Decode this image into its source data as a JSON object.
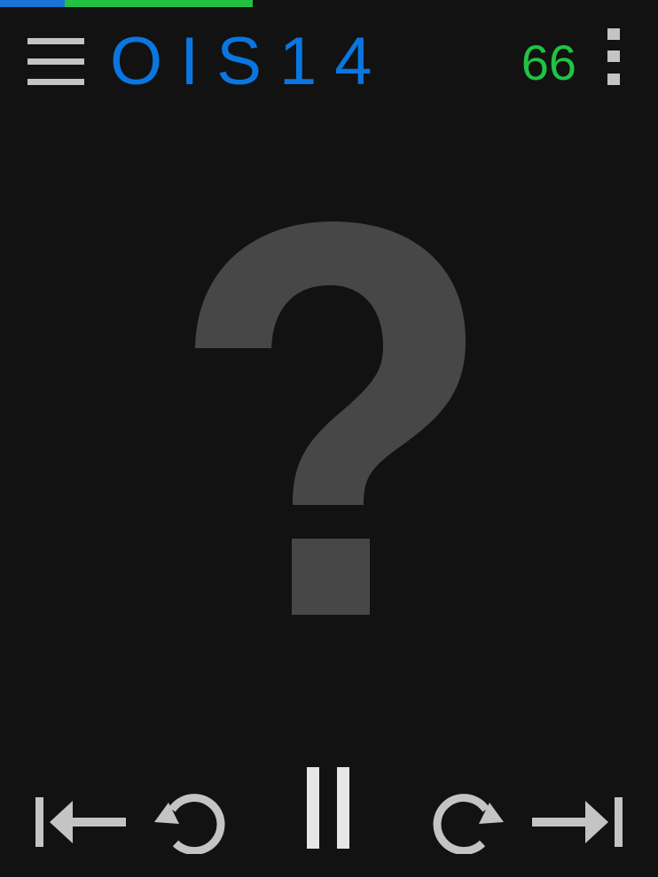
{
  "progress": {
    "colors": {
      "track": "#121212",
      "first": "#1a73d9",
      "second": "#22c141"
    },
    "first_fraction": 0.099,
    "second_fraction": 0.385
  },
  "header": {
    "title": "OIS14",
    "title_color": "#0a76e0",
    "counter": "66",
    "counter_color": "#20c343",
    "menu_icon": "hamburger-menu-icon",
    "more_icon": "vertical-dots-icon"
  },
  "art": {
    "icon": "question-mark-icon",
    "color": "#474747"
  },
  "transport": {
    "icon_color": "#c4c4c4",
    "pause_color": "#e6e6e6",
    "buttons": [
      {
        "name": "skip-previous",
        "icon": "skip-to-start-icon"
      },
      {
        "name": "rewind",
        "icon": "rotate-back-icon"
      },
      {
        "name": "pause",
        "icon": "pause-icon"
      },
      {
        "name": "forward",
        "icon": "rotate-forward-icon"
      },
      {
        "name": "skip-next",
        "icon": "skip-to-end-icon"
      }
    ]
  }
}
